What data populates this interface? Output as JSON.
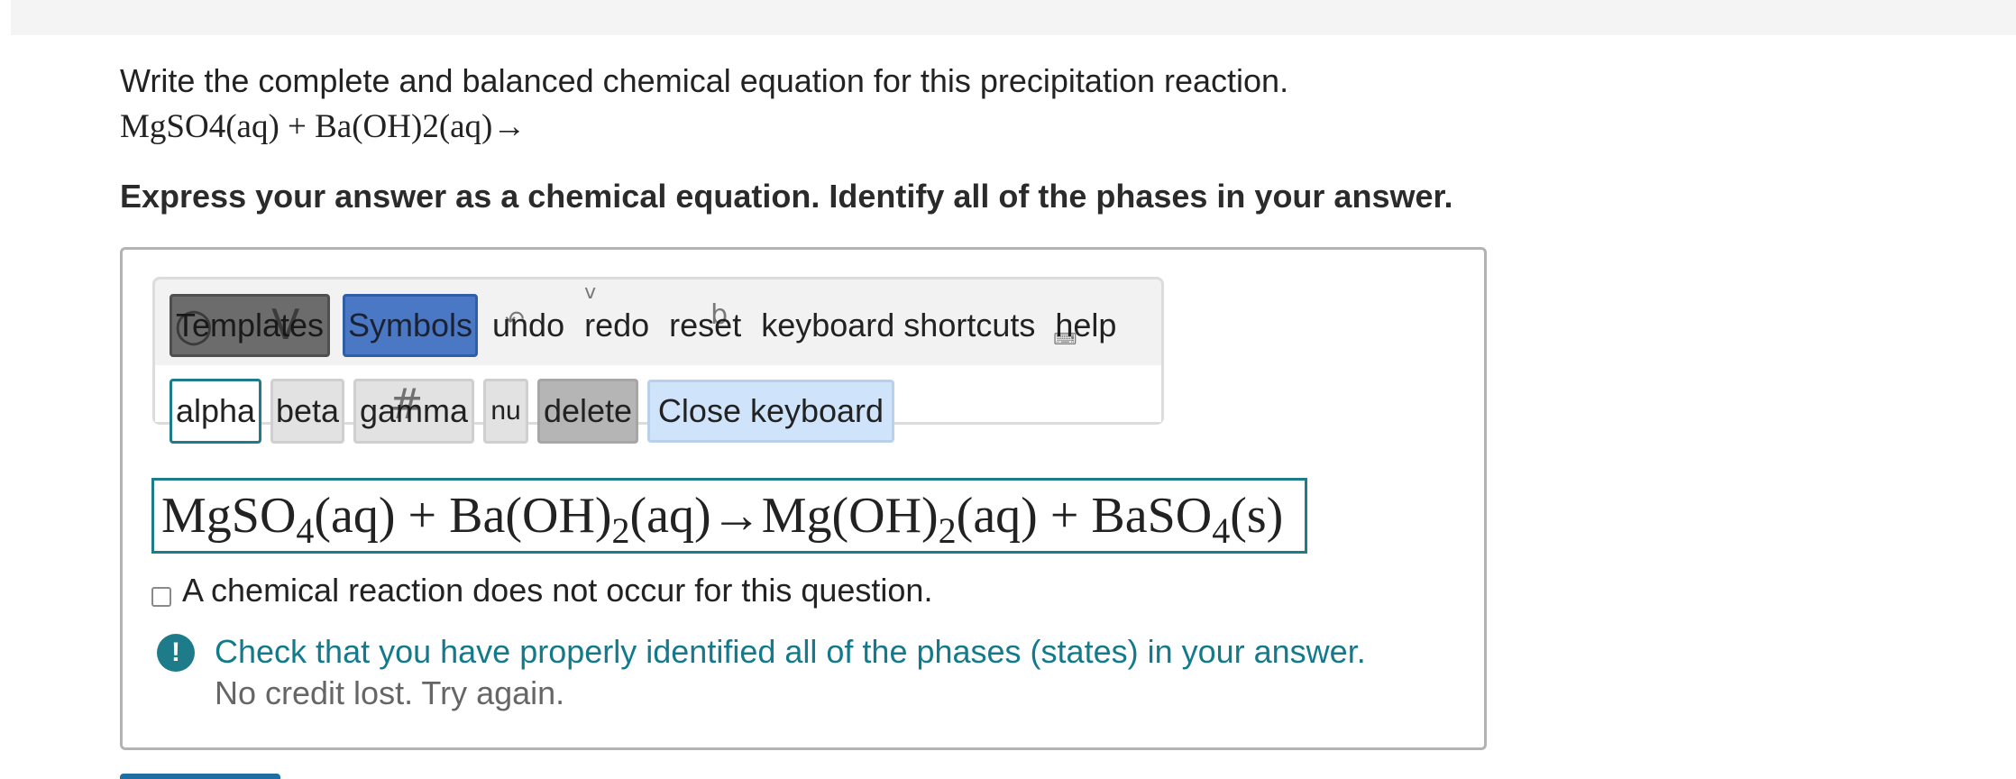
{
  "question": {
    "prompt": "Write the complete and balanced chemical equation for this precipitation reaction.",
    "reactants": "MgSO4(aq) + Ba(OH)2(aq)→",
    "instruction": "Express your answer as a chemical equation. Identify all of the phases in your answer."
  },
  "toolbar": {
    "templates_label": "Templates",
    "symbols_label": "Symbols",
    "undo_label": "undo",
    "redo_label": "redo",
    "reset_label": "reset",
    "shortcuts_label": "keyboard shortcuts",
    "help_label": "help"
  },
  "keyboard": {
    "keys": [
      "alpha",
      "beta",
      "gamma",
      "nu",
      "delete"
    ],
    "close_label": "Close keyboard"
  },
  "answer": {
    "parts": {
      "r1a": "MgSO",
      "r1s": "4",
      "r1b": "(aq)",
      "plus1": " + ",
      "r2a": "Ba(OH)",
      "r2s": "2",
      "r2b": "(aq)",
      "arrow": "→",
      "p1a": "Mg(OH)",
      "p1s": "2",
      "p1b": "(aq)",
      "plus2": " + ",
      "p2a": "BaSO",
      "p2s": "4",
      "p2b": "(s)"
    }
  },
  "no_reaction": {
    "label": "A chemical reaction does not occur for this question.",
    "checked": false
  },
  "feedback": {
    "icon": "!",
    "message": "Check that you have properly identified all of the phases (states) in your answer.",
    "subtext": "No credit lost. Try again."
  },
  "colors": {
    "accent": "#1d7b8a",
    "symbols_button": "#4a78c4",
    "templates_button": "#6c6c6c",
    "close_keyboard": "#cfe4fb"
  }
}
